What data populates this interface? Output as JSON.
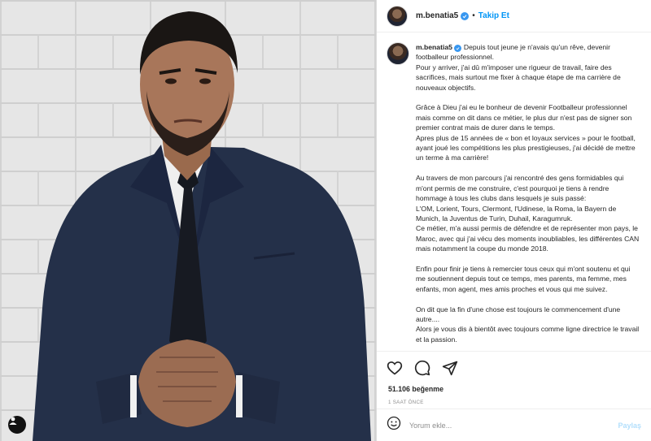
{
  "header": {
    "username": "m.benatia5",
    "separator": "•",
    "follow_label": "Takip Et"
  },
  "caption": {
    "username": "m.benatia5",
    "text": "Depuis tout jeune je n'avais qu'un rêve, devenir footballeur professionnel.\nPour y arriver, j'ai dû m'imposer une rigueur de travail, faire des sacrifices, mais surtout me fixer à chaque étape de ma carrière de nouveaux objectifs.\n\nGrâce à Dieu j'ai eu le bonheur de devenir Footballeur professionnel mais comme on dit dans ce métier, le plus dur n'est pas de signer son premier contrat mais de durer dans le temps.\nApres plus de 15 années de « bon et loyaux services » pour le football, ayant joué les compétitions les plus prestigieuses, j'ai décidé de mettre un terme à ma carrière!\n\nAu travers de mon parcours j'ai rencontré des gens formidables qui m'ont permis de me construire, c'est pourquoi je tiens à rendre hommage à tous les clubs dans lesquels je suis passé:\nL'OM, Lorient, Tours, Clermont, l'Udinese, la Roma, la Bayern de Munich, la Juventus de Turin, Duhail, Karagumruk.\nCe métier, m'a aussi permis de défendre et de représenter mon pays, le Maroc, avec qui j'ai vécu des moments inoubliables, les différentes CAN mais notamment la coupe du monde 2018.\n\nEnfin pour finir je tiens à remercier tous ceux qui m'ont soutenu et qui me soutiennent depuis tout ce temps, mes parents, ma femme, mes enfants, mon agent, mes amis proches et vous qui me suivez.\n\nOn dit que la fin d'une chose est toujours le commencement d'une autre....\nAlors je vous dis à bientôt avec toujours comme ligne directrice le travail et la passion."
  },
  "actions": {
    "icons": [
      "heart-icon",
      "comment-icon",
      "share-icon"
    ],
    "likes": "51.106 beğenme",
    "time": "1 SAAT ÖNCE"
  },
  "comment": {
    "placeholder": "Yorum ekle...",
    "post_label": "Paylaş"
  },
  "colors": {
    "accent": "#0095f6",
    "verified": "#3897f0",
    "muted": "#8e8e8e",
    "post_disabled": "#b2dffc"
  }
}
